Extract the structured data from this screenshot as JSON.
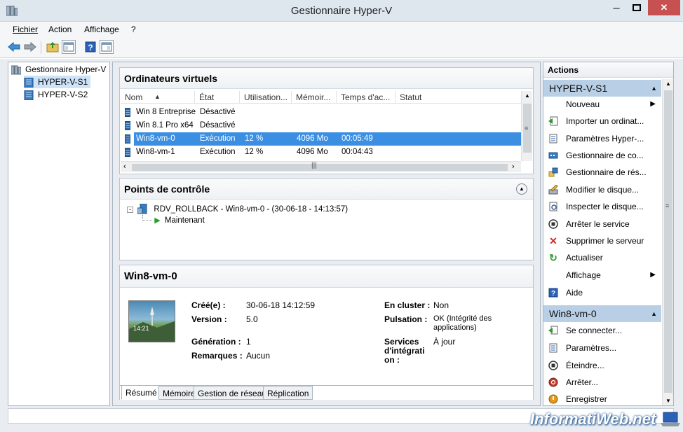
{
  "window": {
    "title": "Gestionnaire Hyper-V",
    "minimize": "─",
    "maximize": "□",
    "close": "✕"
  },
  "menu": {
    "fichier": "Fichier",
    "action": "Action",
    "affichage": "Affichage",
    "help": "?"
  },
  "tree": {
    "root": "Gestionnaire Hyper-V",
    "servers": [
      "HYPER-V-S1",
      "HYPER-V-S2"
    ]
  },
  "vms": {
    "title": "Ordinateurs virtuels",
    "columns": [
      "Nom",
      "État",
      "Utilisation...",
      "Mémoir...",
      "Temps d'ac...",
      "Statut"
    ],
    "rows": [
      {
        "name": "Win 8 Entreprise",
        "state": "Désactivé",
        "cpu": "",
        "mem": "",
        "uptime": "",
        "status": ""
      },
      {
        "name": "Win 8.1 Pro x64",
        "state": "Désactivé",
        "cpu": "",
        "mem": "",
        "uptime": "",
        "status": ""
      },
      {
        "name": "Win8-vm-0",
        "state": "Exécution",
        "cpu": "12 %",
        "mem": "4096 Mo",
        "uptime": "00:05:49",
        "status": ""
      },
      {
        "name": "Win8-vm-1",
        "state": "Exécution",
        "cpu": "12 %",
        "mem": "4096 Mo",
        "uptime": "00:04:43",
        "status": ""
      }
    ],
    "selected_index": 2
  },
  "checkpoints": {
    "title": "Points de contrôle",
    "items": [
      "RDV_ROLLBACK - Win8-vm-0 - (30-06-18 - 14:13:57)"
    ],
    "now": "Maintenant"
  },
  "details": {
    "title": "Win8-vm-0",
    "thumb_time": "14:21",
    "created_label": "Créé(e) :",
    "created": "30-06-18 14:12:59",
    "version_label": "Version :",
    "version": "5.0",
    "generation_label": "Génération :",
    "generation": "1",
    "notes_label": "Remarques :",
    "notes": "Aucun",
    "cluster_label": "En cluster :",
    "cluster": "Non",
    "heartbeat_label": "Pulsation :",
    "heartbeat_1": "OK (Intégrité des",
    "heartbeat_2": "applications)",
    "services_label_1": "Services",
    "services_label_2": "d'intégrati",
    "services_label_3": "on :",
    "services": "À jour",
    "tabs": [
      "Résumé",
      "Mémoire",
      "Gestion de réseau",
      "Réplication"
    ]
  },
  "actions": {
    "header": "Actions",
    "server_group": "HYPER-V-S1",
    "server_items": [
      "Nouveau",
      "Importer un ordinat...",
      "Paramètres Hyper-...",
      "Gestionnaire de co...",
      "Gestionnaire de rés...",
      "Modifier le disque...",
      "Inspecter le disque...",
      "Arrêter le service",
      "Supprimer le serveur",
      "Actualiser",
      "Affichage",
      "Aide"
    ],
    "vm_group": "Win8-vm-0",
    "vm_items": [
      "Se connecter...",
      "Paramètres...",
      "Éteindre...",
      "Arrêter...",
      "Enregistrer"
    ]
  },
  "watermark": "InformatiWeb.net"
}
